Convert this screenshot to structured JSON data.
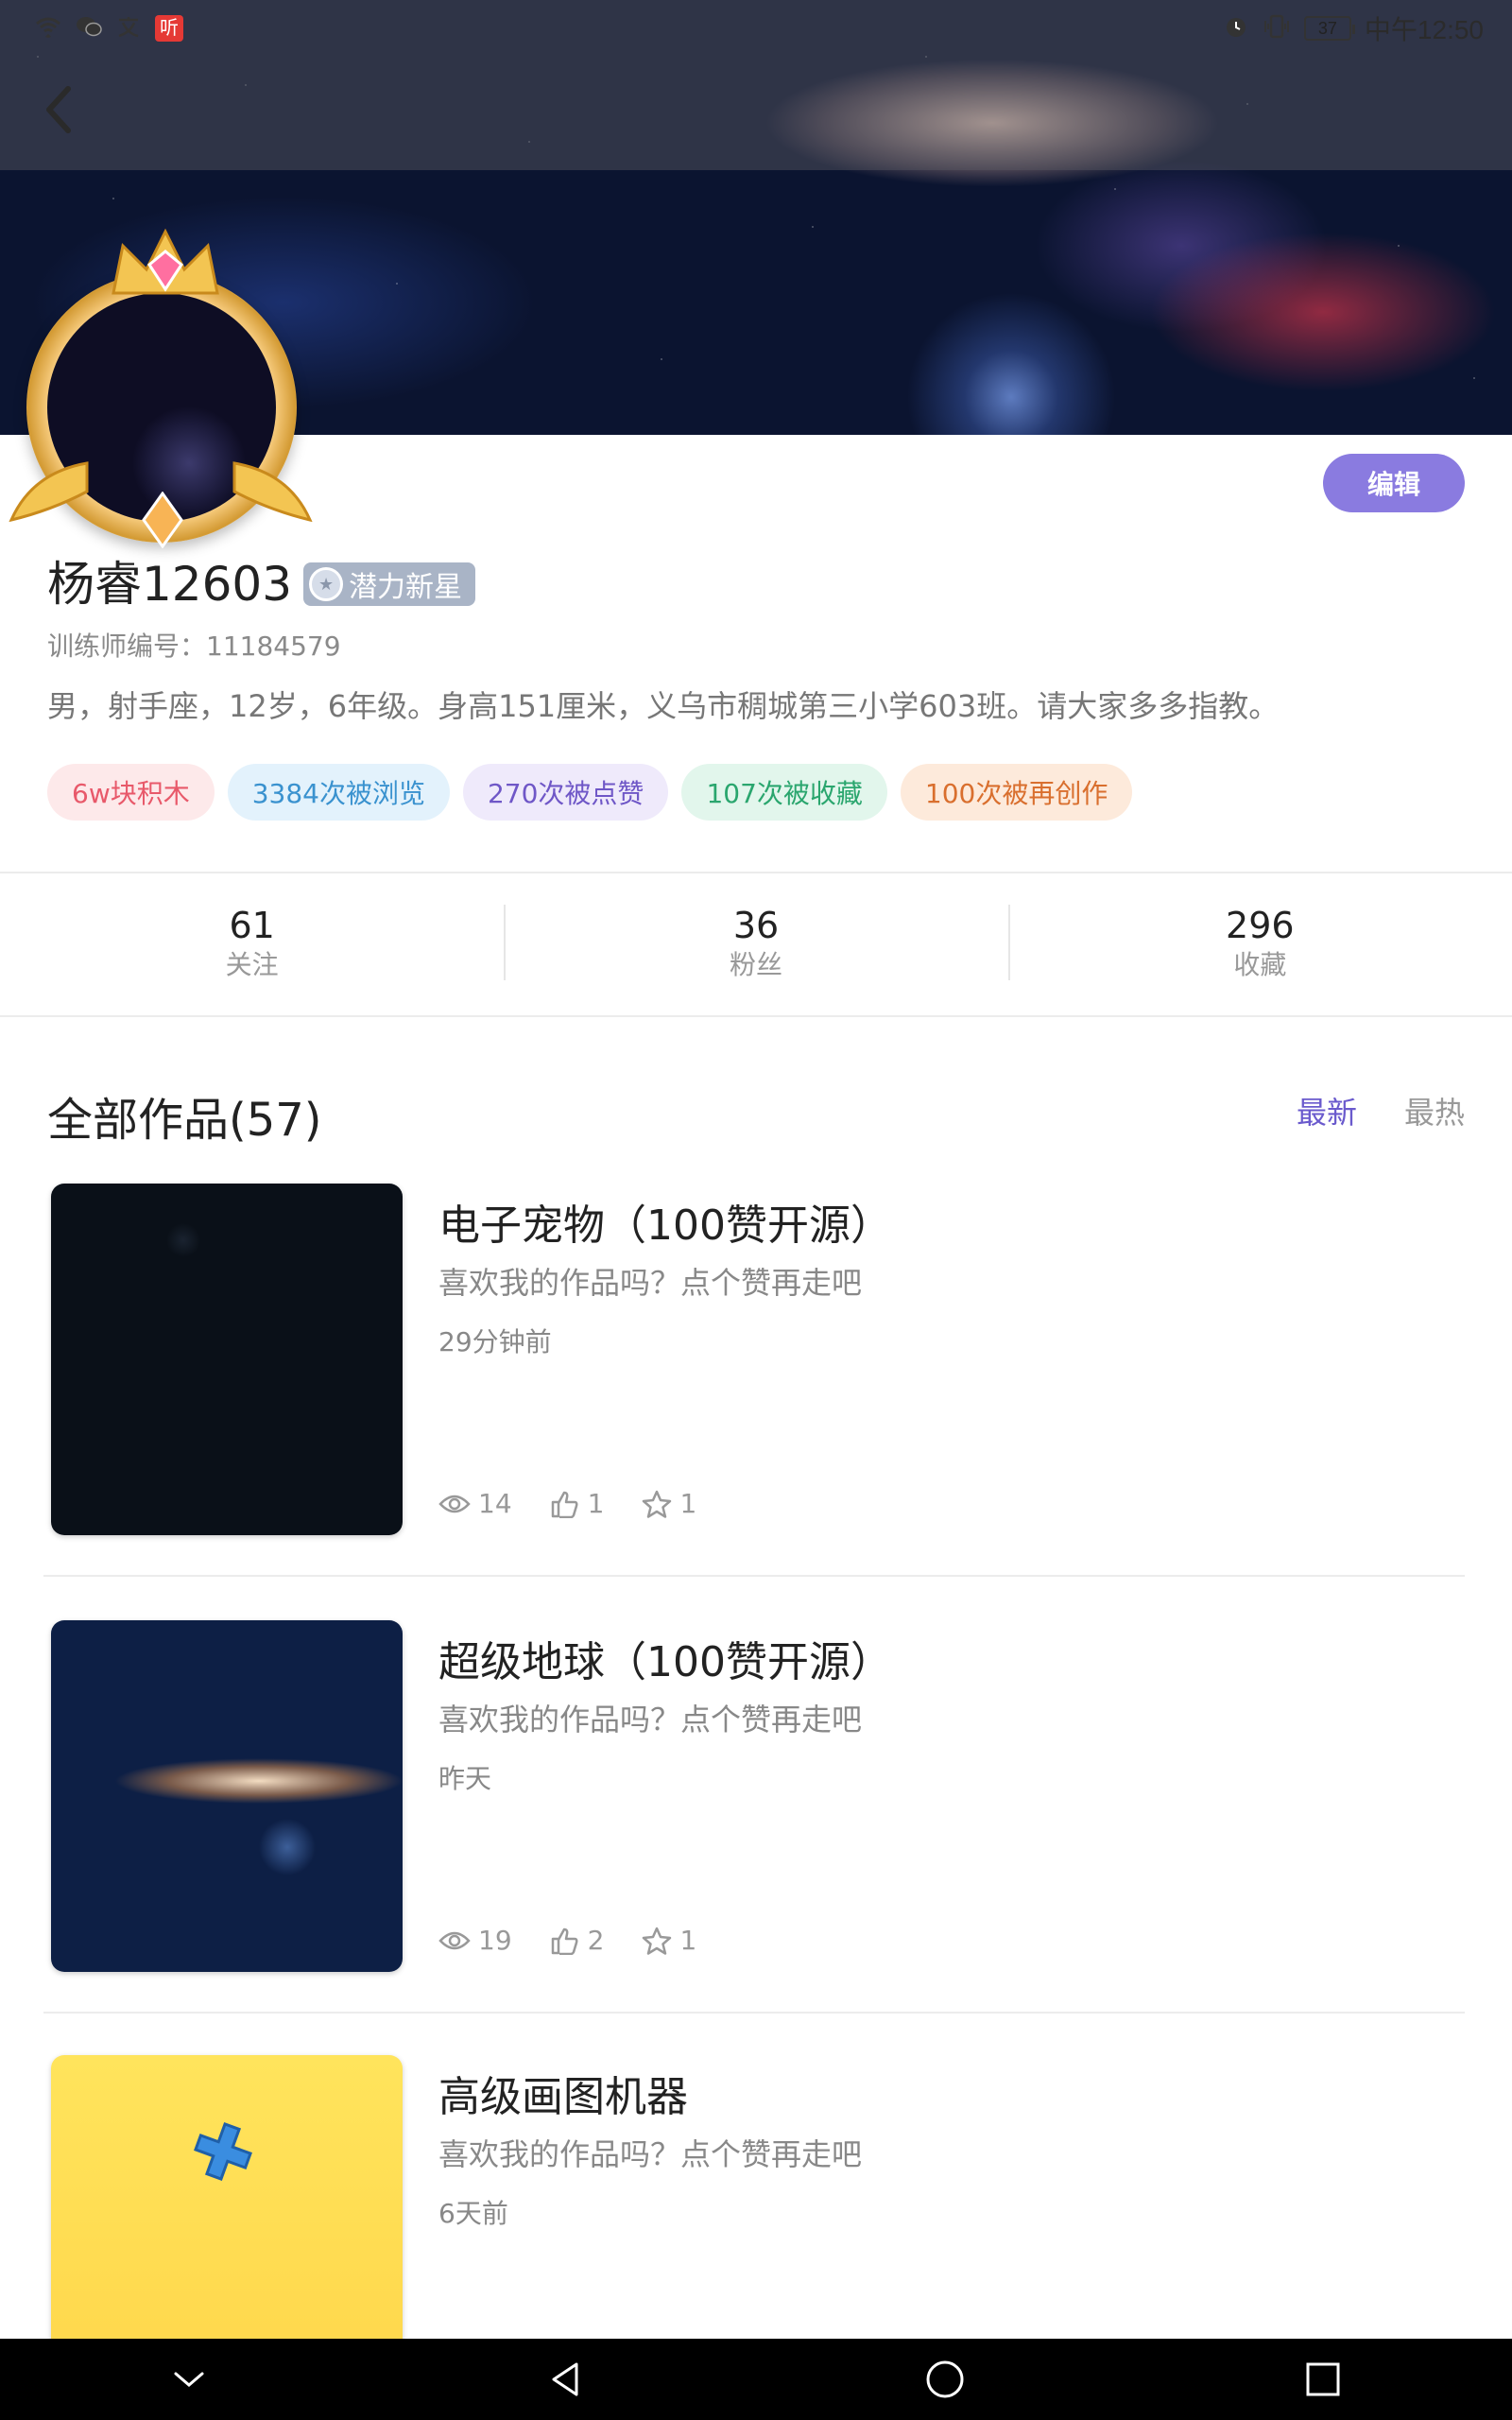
{
  "status_bar": {
    "battery": "37",
    "time": "中午12:50",
    "notify_badge": "听"
  },
  "profile": {
    "name": "杨睿12603",
    "rank": "潜力新星",
    "trainer_id": "训练师编号：11184579",
    "bio": "男，射手座，12岁，6年级。身高151厘米，义乌市稠城第三小学603班。请大家多多指教。",
    "edit_label": "编辑"
  },
  "tags": [
    {
      "label": "6w块积木",
      "color": "#e8596a",
      "bg": "#fde9ea"
    },
    {
      "label": "3384次被浏览",
      "color": "#3a92cf",
      "bg": "#e3f2fc"
    },
    {
      "label": "270次被点赞",
      "color": "#6f57c7",
      "bg": "#efeafb"
    },
    {
      "label": "107次被收藏",
      "color": "#2aa66e",
      "bg": "#e2f6ec"
    },
    {
      "label": "100次被再创作",
      "color": "#d96f2e",
      "bg": "#fdeadb"
    }
  ],
  "stats": [
    {
      "value": "61",
      "label": "关注"
    },
    {
      "value": "36",
      "label": "粉丝"
    },
    {
      "value": "296",
      "label": "收藏"
    }
  ],
  "works": {
    "title": "全部作品(57)",
    "sort_tabs": [
      {
        "label": "最新",
        "active": true
      },
      {
        "label": "最热",
        "active": false
      }
    ],
    "items": [
      {
        "title": "电子宠物（100赞开源）",
        "desc": "喜欢我的作品吗？点个赞再走吧",
        "time": "29分钟前",
        "views": "14",
        "likes": "1",
        "favs": "1"
      },
      {
        "title": "超级地球（100赞开源）",
        "desc": "喜欢我的作品吗？点个赞再走吧",
        "time": "昨天",
        "views": "19",
        "likes": "2",
        "favs": "1"
      },
      {
        "title": "高级画图机器",
        "desc": "喜欢我的作品吗？点个赞再走吧",
        "time": "6天前"
      }
    ]
  },
  "colors": {
    "accent": "#8a7be0",
    "active_tab": "#6a5acd"
  }
}
